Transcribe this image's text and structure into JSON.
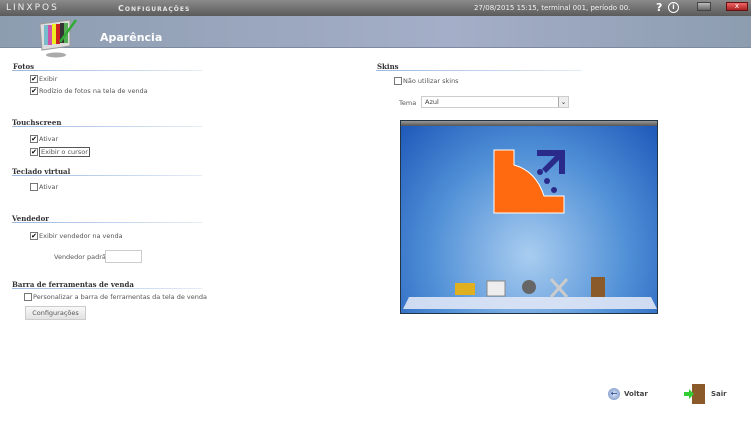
{
  "topbar": {
    "brand": "LINXPOS",
    "title": "Configurações",
    "status": "27/08/2015 15:15, terminal 001, período 00.",
    "help": "?",
    "info": "i",
    "close": "x"
  },
  "header": {
    "title": "Aparência"
  },
  "fotos": {
    "title": "Fotos",
    "exibir": "Exibir",
    "exibir_checked": true,
    "rodizio": "Rodízio de fotos na tela de venda",
    "rodizio_checked": true
  },
  "touchscreen": {
    "title": "Touchscreen",
    "ativar": "Ativar",
    "ativar_checked": true,
    "cursor": "Exibir o cursor",
    "cursor_checked": true
  },
  "teclado": {
    "title": "Teclado virtual",
    "ativar": "Ativar",
    "ativar_checked": false
  },
  "vendedor": {
    "title": "Vendedor",
    "exibir": "Exibir vendedor na venda",
    "exibir_checked": true,
    "padrao_label": "Vendedor padrão",
    "padrao_value": ""
  },
  "barra": {
    "title": "Barra de ferramentas de venda",
    "personalizar": "Personalizar a barra de ferramentas da tela de venda",
    "personalizar_checked": false,
    "config_button": "Configurações"
  },
  "skins": {
    "title": "Skins",
    "nao_utilizar": "Não utilizar skins",
    "nao_utilizar_checked": false,
    "tema_label": "Tema",
    "tema_value": "Azul"
  },
  "footer": {
    "voltar": "Voltar",
    "sair": "Sair"
  }
}
